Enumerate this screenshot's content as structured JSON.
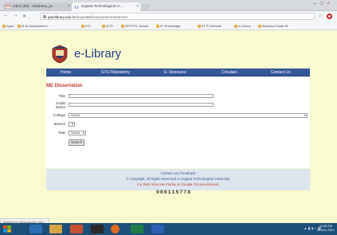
{
  "browser": {
    "tabs": [
      {
        "label": "Inbox (30) - drashana_pr..."
      },
      {
        "label": "Gujarat Technological U..."
      }
    ],
    "url_domain": "gtuelibrary.edu.in",
    "url_path": "/GujaratElibrary/search/searchmr",
    "bookmarks": [
      "Apps",
      "M.Sc Assessment...",
      "IIT1",
      "AI PI",
      "OFFPOL School",
      "IIT Knowledge",
      "IIT PI Website",
      "e-Library",
      "Malaviya Sarak IN"
    ]
  },
  "site": {
    "name": "e-Library",
    "nav": [
      "Home",
      "GTU Repository",
      "E- Resource",
      "Circulars",
      "Contact Us"
    ]
  },
  "form": {
    "title": "ME Dissertation",
    "title_label": "Title",
    "guide_label": "Guide Name",
    "college_label": "College",
    "college_value": "Select",
    "branch_label": "Branch",
    "year_label": "Year",
    "year_value": "Select",
    "search_label": "Search"
  },
  "footer": {
    "line1": "Contact Us | Feedback",
    "line2": "© Copyright. All Rights Reserved to Gujarat Technological University",
    "line3": "For Best View use Firefox or Google Chrome Browser",
    "counter": "000115778"
  },
  "status_text": "Waiting for www.google.com...",
  "taskbar": {
    "time": "10:05 PM",
    "date": "24-Dec-2014"
  },
  "colors": {
    "nav_bar": "#34569c",
    "page_bg": "#fafad0",
    "accent_red": "#c0392b",
    "site_name": "#213a8a"
  }
}
